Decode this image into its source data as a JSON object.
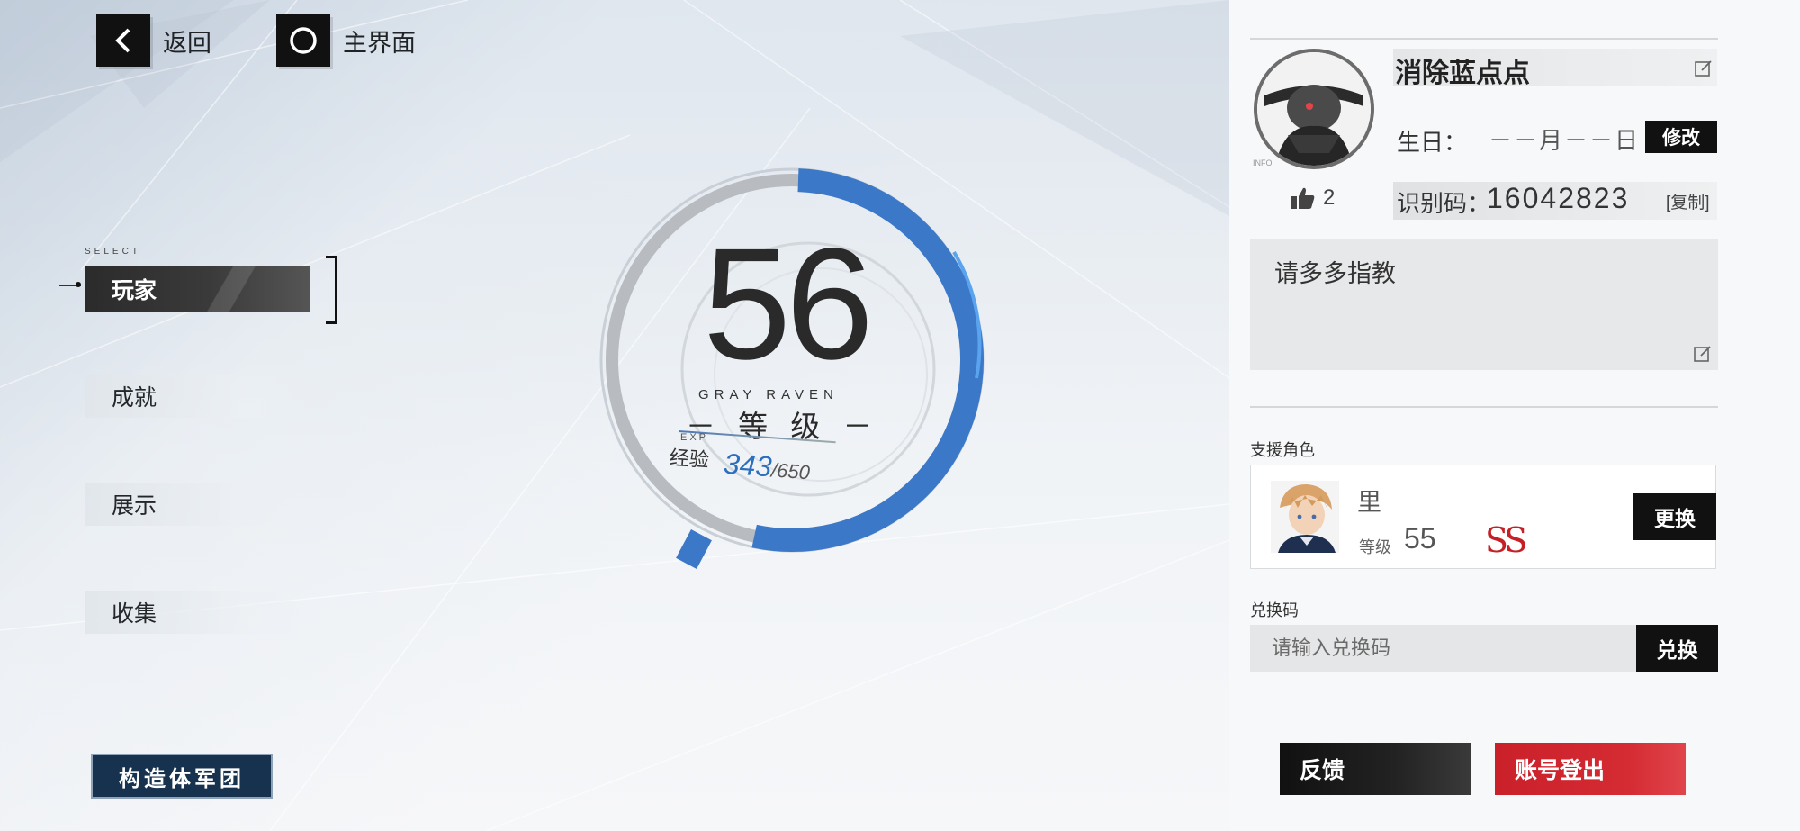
{
  "topbar": {
    "back_label": "返回",
    "home_label": "主界面"
  },
  "nav": {
    "select_tag": "SELECT",
    "items": [
      {
        "label": "玩家",
        "active": true
      },
      {
        "label": "成就",
        "active": false
      },
      {
        "label": "展示",
        "active": false
      },
      {
        "label": "收集",
        "active": false
      }
    ],
    "legion_label": "构造体军团"
  },
  "level": {
    "value": "56",
    "subtitle": "GRAY RAVEN",
    "label": "－ 等 级 －",
    "exp_tag": "EXP",
    "exp_label": "经验",
    "exp_current": "343",
    "exp_max": "/650",
    "exp_progress": 0.528
  },
  "profile": {
    "username": "消除蓝点点",
    "birthday_label": "生日：",
    "birthday_value": "－－月－－日",
    "modify_label": "修改",
    "id_label": "识别码：",
    "id_value": "16042823",
    "copy_label": "[复制]",
    "likes": "2",
    "signature": "请多多指教"
  },
  "support": {
    "section_label": "支援角色",
    "name": "里",
    "level_label": "等级",
    "level": "55",
    "rank": "SS",
    "swap_label": "更换"
  },
  "redeem": {
    "section_label": "兑换码",
    "placeholder": "请输入兑换码",
    "button_label": "兑换"
  },
  "footer": {
    "feedback_label": "反馈",
    "logout_label": "账号登出"
  },
  "colors": {
    "accent_blue": "#3b78c8",
    "logout_red": "#d1262f",
    "legion_navy": "#17324f"
  }
}
